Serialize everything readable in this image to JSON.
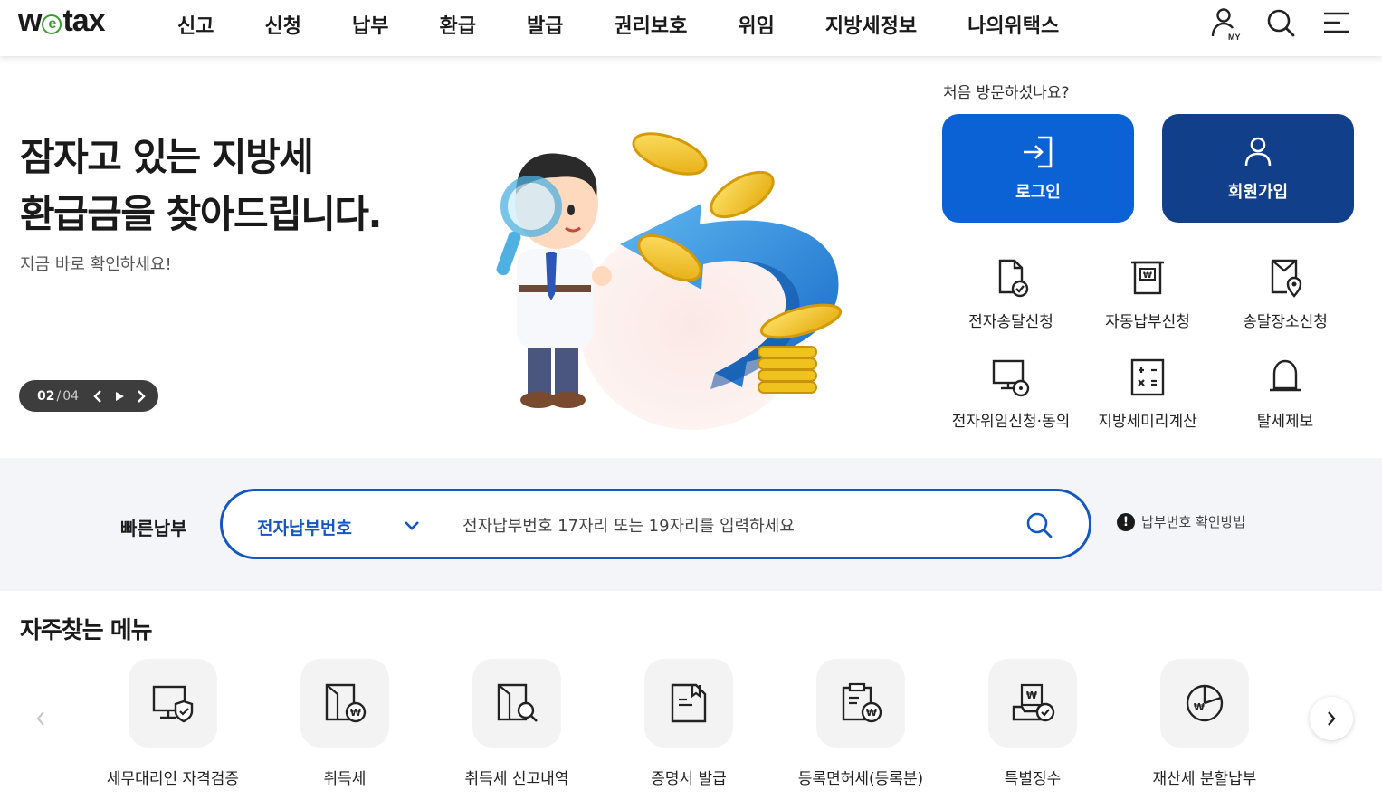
{
  "brand": {
    "logo_pre": "w",
    "logo_e": "e",
    "logo_post": "tax"
  },
  "nav": [
    "신고",
    "신청",
    "납부",
    "환급",
    "발급",
    "권리보호",
    "위임",
    "지방세정보",
    "나의위택스"
  ],
  "header_icons": {
    "my_badge": "MY",
    "items": [
      "my-user-icon",
      "search-icon",
      "menu-icon"
    ]
  },
  "hero": {
    "title_line1": "잠자고 있는 지방세",
    "title_line2": "환급금을 찾아드립니다.",
    "subtitle": "지금 바로 확인하세요!",
    "slide_current": "02",
    "slide_total": "04"
  },
  "account": {
    "question": "처음 방문하셨나요?",
    "login_label": "로그인",
    "join_label": "회원가입"
  },
  "services": [
    {
      "label": "전자송달신청",
      "icon": "doc-check-icon"
    },
    {
      "label": "자동납부신청",
      "icon": "auto-pay-icon"
    },
    {
      "label": "송달장소신청",
      "icon": "location-doc-icon"
    },
    {
      "label": "전자위임신청·동의",
      "icon": "monitor-doc-icon"
    },
    {
      "label": "지방세미리계산",
      "icon": "calculator-icon"
    },
    {
      "label": "탈세제보",
      "icon": "alarm-bell-icon"
    }
  ],
  "quickpay": {
    "label": "빠른납부",
    "select_value": "전자납부번호",
    "placeholder": "전자납부번호 17자리 또는 19자리를 입력하세요",
    "help_label": "납부번호 확인방법"
  },
  "frequent": {
    "title": "자주찾는 메뉴",
    "items": [
      {
        "label": "세무대리인 자격검증",
        "icon": "monitor-shield-icon"
      },
      {
        "label": "취득세",
        "icon": "building-won-icon"
      },
      {
        "label": "취득세 신고내역",
        "icon": "building-search-icon"
      },
      {
        "label": "증명서 발급",
        "icon": "certificate-icon"
      },
      {
        "label": "등록면허세(등록분)",
        "icon": "clipboard-won-icon"
      },
      {
        "label": "특별징수",
        "icon": "tray-check-icon"
      },
      {
        "label": "재산세 분할납부",
        "icon": "pie-won-icon"
      }
    ]
  },
  "colors": {
    "primary": "#0b62d4",
    "navy": "#123f8a",
    "quickpay_border": "#1257c2",
    "logo_green": "#3a9b2f"
  }
}
